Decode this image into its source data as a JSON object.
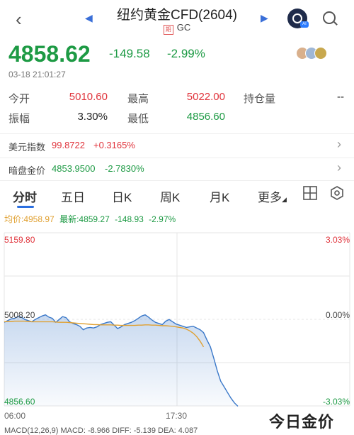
{
  "header": {
    "title": "纽约黄金CFD(2604)",
    "subtitle_badge": "期",
    "subtitle": "GC",
    "prev_arrow": "◀",
    "next_arrow": "▶",
    "back_icon": "‹",
    "ai_tag": "AI"
  },
  "quote": {
    "price": "4858.62",
    "change": "-149.58",
    "change_pct": "-2.99%",
    "timestamp": "03-18 21:01:27",
    "color_down": "#1d9a44",
    "color_up": "#e0343c"
  },
  "stats": [
    {
      "label": "今开",
      "value": "5010.60",
      "color": "#e0343c"
    },
    {
      "label": "最高",
      "value": "5022.00",
      "color": "#e0343c"
    },
    {
      "label": "持仓量",
      "value": "--",
      "color": "#222222"
    },
    {
      "label": "振幅",
      "value": "3.30%",
      "color": "#222222"
    },
    {
      "label": "最低",
      "value": "4856.60",
      "color": "#1d9a44"
    }
  ],
  "related": [
    {
      "label": "美元指数",
      "value": "99.8722",
      "change": "+0.3165%",
      "color": "#e0343c"
    },
    {
      "label": "暗盘金价",
      "value": "4853.9500",
      "change": "-2.7830%",
      "color": "#1d9a44"
    }
  ],
  "tabs": [
    {
      "label": "分时",
      "active": true
    },
    {
      "label": "五日",
      "active": false
    },
    {
      "label": "日K",
      "active": false
    },
    {
      "label": "周K",
      "active": false
    },
    {
      "label": "月K",
      "active": false
    },
    {
      "label": "更多",
      "active": false
    }
  ],
  "toolbar_icons": [
    "grid-icon",
    "settings-icon"
  ],
  "legend": {
    "avg_label": "均价:4958.97",
    "latest_label": "最新:4859.27",
    "latest_change": "-148.93",
    "latest_pct": "-2.97%"
  },
  "chart_data": {
    "type": "line",
    "y_left_ticks": [
      "5159.80",
      "5008.20",
      "4856.60"
    ],
    "y_right_ticks": [
      "3.03%",
      "0.00%",
      "-3.03%"
    ],
    "x_ticks": [
      "06:00",
      "17:30"
    ],
    "ylim": [
      4856.6,
      5159.8
    ],
    "reference_price": 5008.2,
    "series": [
      {
        "style": "area",
        "color": "#3a78c9",
        "values": [
          5003,
          5006,
          5009,
          5010,
          5013,
          5012,
          5008,
          5006,
          5004,
          5008,
          5011,
          5014,
          5016,
          5012,
          5010,
          5003,
          5008,
          5013,
          5011,
          5004,
          5001,
          4999,
          4996,
          4990,
          4993,
          4994,
          4993,
          4995,
          4999,
          5001,
          5003,
          5004,
          4998,
          4992,
          4995,
          4999,
          5001,
          5003,
          5006,
          5010,
          5014,
          5016,
          5012,
          5007,
          5003,
          5001,
          4999,
          5005,
          5008,
          5004,
          5000,
          4998,
          4996,
          4994,
          4995,
          4996,
          4993,
          4990,
          4985,
          4972,
          4960,
          4940,
          4918,
          4900,
          4890,
          4880,
          4870,
          4862,
          4856
        ]
      },
      {
        "style": "line",
        "color": "#e0a030",
        "values": [
          5004,
          5004.5,
          5004.5,
          5005,
          5005,
          5005,
          5005,
          5004.5,
          5004,
          5004,
          5004,
          5004,
          5004,
          5004,
          5004,
          5003.5,
          5003,
          5003,
          5003,
          5002.5,
          5002,
          5001.5,
          5001,
          5000.5,
          5000,
          4999.5,
          4999,
          4999,
          4998.5,
          4998.5,
          4998.5,
          4998.5,
          4998,
          4998,
          4997.5,
          4997.5,
          4997.5,
          4997.5,
          4997.5,
          4998,
          4998,
          4998.5,
          4998.5,
          4998,
          4998,
          4997.5,
          4997,
          4997,
          4996.5,
          4996,
          4995,
          4994,
          4993,
          4991,
          4988,
          4984,
          4978,
          4970,
          4960
        ]
      }
    ]
  },
  "watermark": "今日金价",
  "bottom_strip": "MACD(12,26,9)  MACD: -8.966  DIFF: -5.139  DEA: 4.087"
}
